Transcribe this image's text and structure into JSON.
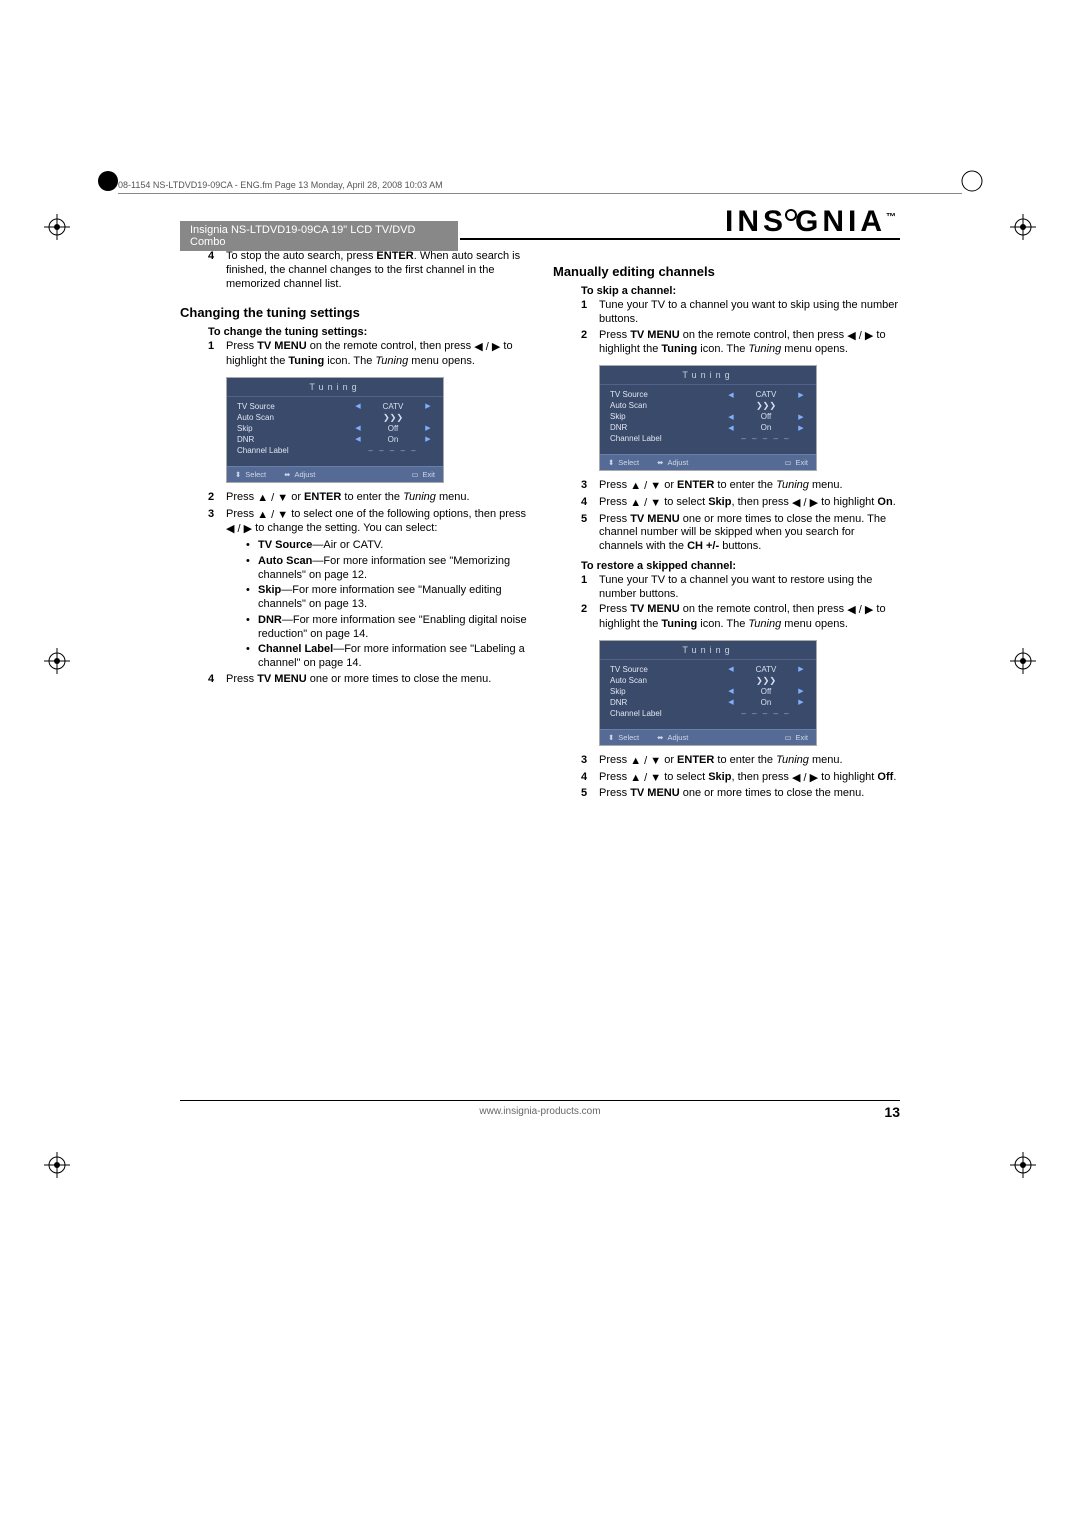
{
  "meta": {
    "frame_header": "08-1154 NS-LTDVD19-09CA - ENG.fm  Page 13  Monday, April 28, 2008  10:03 AM"
  },
  "brand": {
    "logo_text": "INSIGNIA",
    "tm": "™"
  },
  "product_bar": "Insignia NS-LTDVD19-09CA 19\" LCD TV/DVD Combo",
  "left": {
    "step4": {
      "num": "4",
      "text_a": "To stop the auto search, press ",
      "bold_a": "ENTER",
      "text_b": ". When auto search is finished, the channel changes to the first channel in the memorized channel list."
    },
    "h2": "Changing the tuning settings",
    "sub": "To change the tuning settings:",
    "s1": {
      "num": "1",
      "a": "Press ",
      "b1": "TV MENU",
      "b": " on the remote control, then press ",
      "c": " to highlight the ",
      "b2": "Tuning",
      "d": " icon. The ",
      "i1": "Tuning",
      "e": " menu opens."
    },
    "s2": {
      "num": "2",
      "a": "Press ",
      "b": " or ",
      "b1": "ENTER",
      "c": " to enter the ",
      "i1": "Tuning",
      "d": " menu."
    },
    "s3": {
      "num": "3",
      "a": "Press ",
      "b": " to select one of the following options, then press ",
      "c": " to change the setting. You can select:"
    },
    "bullets": {
      "tv_source": {
        "b": "TV Source",
        "t": "—Air or CATV."
      },
      "auto_scan": {
        "b": "Auto Scan",
        "t": "—For more information see \"Memorizing channels\" on page 12."
      },
      "skip": {
        "b": "Skip",
        "t": "—For more information see \"Manually editing channels\" on page 13."
      },
      "dnr": {
        "b": "DNR",
        "t": "—For more information see \"Enabling digital noise reduction\" on page 14."
      },
      "ch_label": {
        "b": "Channel Label",
        "t": "—For more information see \"Labeling a channel\" on page 14."
      }
    },
    "s4": {
      "num": "4",
      "a": "Press ",
      "b1": "TV MENU",
      "b": " one or more times to close the menu."
    }
  },
  "right": {
    "h2": "Manually editing channels",
    "subA": "To skip a channel:",
    "A1": {
      "num": "1",
      "t": "Tune your TV to a channel you want to skip using the number buttons."
    },
    "A2": {
      "num": "2",
      "a": "Press ",
      "b1": "TV MENU",
      "b": " on the remote control, then press ",
      "c": " to highlight the ",
      "b2": "Tuning",
      "d": " icon. The ",
      "i1": "Tuning",
      "e": " menu opens."
    },
    "A3": {
      "num": "3",
      "a": "Press ",
      "b": " or ",
      "b1": "ENTER",
      "c": " to enter the ",
      "i1": "Tuning",
      "d": " menu."
    },
    "A4": {
      "num": "4",
      "a": "Press ",
      "b": " to select ",
      "b1": "Skip",
      "c": ", then press ",
      "d": " to highlight ",
      "b2": "On",
      "e": "."
    },
    "A5": {
      "num": "5",
      "a": "Press ",
      "b1": "TV MENU",
      "b": " one or more times to close the menu. The channel number will be skipped when you search for channels with the ",
      "b2": "CH +/-",
      "c": " buttons."
    },
    "subB": "To restore a skipped channel:",
    "B1": {
      "num": "1",
      "t": "Tune your TV to a channel you want to restore using the number buttons."
    },
    "B2": {
      "num": "2",
      "a": "Press ",
      "b1": "TV MENU",
      "b": " on the remote control, then press ",
      "c": " to highlight the ",
      "b2": "Tuning",
      "d": " icon. The ",
      "i1": "Tuning",
      "e": " menu opens."
    },
    "B3": {
      "num": "3",
      "a": "Press ",
      "b": " or ",
      "b1": "ENTER",
      "c": " to enter the ",
      "i1": "Tuning",
      "d": " menu."
    },
    "B4": {
      "num": "4",
      "a": "Press ",
      "b": " to select ",
      "b1": "Skip",
      "c": ", then press ",
      "d": " to highlight ",
      "b2": "Off",
      "e": "."
    },
    "B5": {
      "num": "5",
      "a": "Press ",
      "b1": "TV MENU",
      "b": " one or more times to close the menu."
    }
  },
  "tuning_menu": {
    "title": "Tuning",
    "rows": {
      "tv_source": {
        "label": "TV Source",
        "val": "CATV"
      },
      "auto_scan": {
        "label": "Auto Scan",
        "symbol": "❯❯❯"
      },
      "skip": {
        "label": "Skip",
        "val": "Off"
      },
      "dnr": {
        "label": "DNR",
        "val": "On"
      },
      "ch_label": {
        "label": "Channel Label",
        "dashes": "– – – – –"
      }
    },
    "footer": {
      "select": "Select",
      "adjust": "Adjust",
      "exit": "Exit"
    }
  },
  "footer": {
    "url": "www.insignia-products.com",
    "page": "13"
  }
}
